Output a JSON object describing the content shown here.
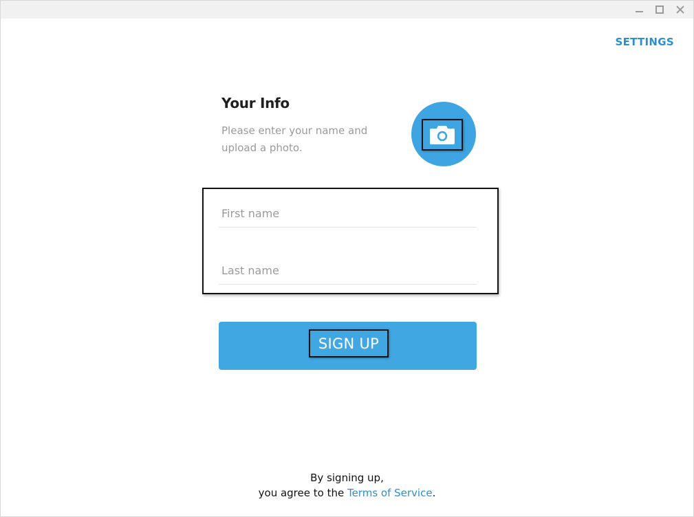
{
  "window": {
    "controls": [
      "minimize-icon",
      "maximize-icon",
      "close-icon"
    ]
  },
  "header": {
    "settings_label": "SETTINGS"
  },
  "info": {
    "title": "Your Info",
    "description": "Please enter your name and upload a photo.",
    "photo_icon": "camera-icon"
  },
  "form": {
    "first_name_placeholder": "First name",
    "first_name_value": "",
    "last_name_placeholder": "Last name",
    "last_name_value": "",
    "signup_label": "SIGN UP"
  },
  "footer": {
    "line1": "By signing up,",
    "line2_prefix": "you agree to the ",
    "terms_link": "Terms of Service",
    "line2_suffix": "."
  },
  "colors": {
    "accent": "#41a7e2",
    "link": "#2a8fd0",
    "muted_text": "#9a9a9a",
    "titlebar": "#f1f1f1"
  }
}
